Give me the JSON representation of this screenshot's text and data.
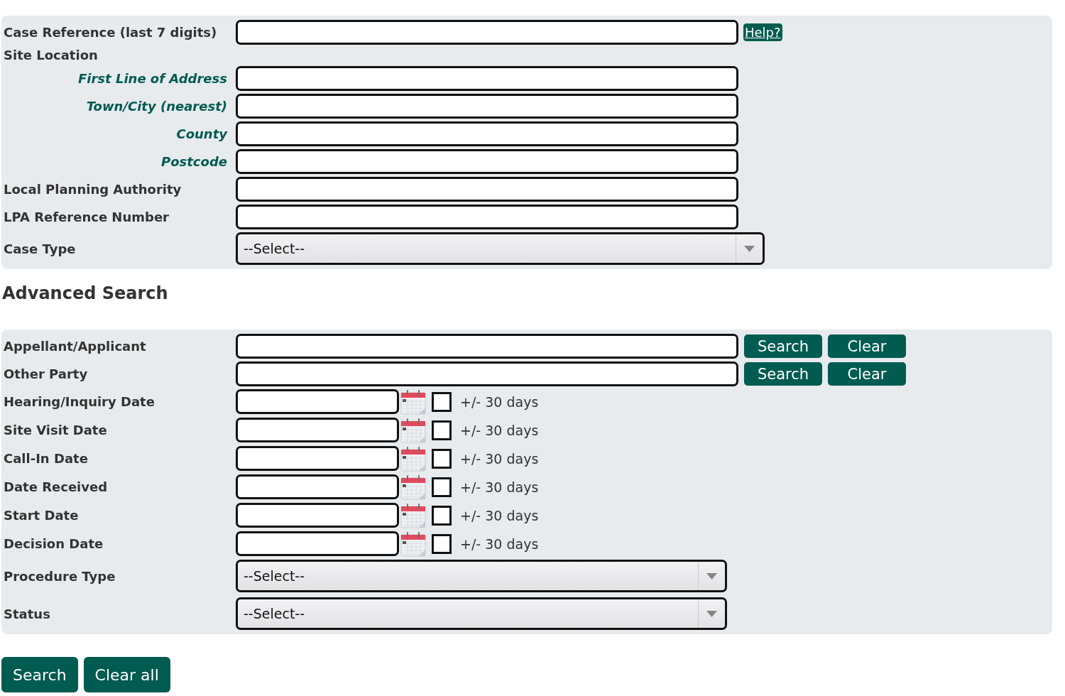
{
  "case_search": {
    "rows": [
      {
        "kind": "text",
        "label": "Case Reference (last 7 digits)",
        "help_link": "Help?"
      },
      {
        "kind": "group",
        "label": "Site Location",
        "children": [
          {
            "kind": "text",
            "label": "First Line of Address"
          },
          {
            "kind": "text",
            "label": "Town/City (nearest)"
          },
          {
            "kind": "text",
            "label": "County"
          },
          {
            "kind": "text",
            "label": "Postcode"
          }
        ]
      },
      {
        "kind": "text",
        "label": "Local Planning Authority"
      },
      {
        "kind": "text",
        "label": "LPA Reference Number"
      },
      {
        "kind": "select",
        "label": "Case Type",
        "value": "--Select--"
      }
    ]
  },
  "advanced_search": {
    "heading": "Advanced Search",
    "rows": [
      {
        "kind": "lookup",
        "label": "Appellant/Applicant",
        "buttons": [
          "Search",
          "Clear"
        ]
      },
      {
        "kind": "lookup",
        "label": "Other Party",
        "buttons": [
          "Search",
          "Clear"
        ]
      },
      {
        "kind": "date",
        "label": "Hearing/Inquiry Date",
        "checked": false,
        "range_label": "+/- 30 days"
      },
      {
        "kind": "date",
        "label": "Site Visit Date",
        "checked": false,
        "range_label": "+/- 30 days"
      },
      {
        "kind": "date",
        "label": "Call-In Date",
        "checked": false,
        "range_label": "+/- 30 days"
      },
      {
        "kind": "date",
        "label": "Date Received",
        "checked": false,
        "range_label": "+/- 30 days"
      },
      {
        "kind": "date",
        "label": "Start Date",
        "checked": false,
        "range_label": "+/- 30 days"
      },
      {
        "kind": "date",
        "label": "Decision Date",
        "checked": false,
        "range_label": "+/- 30 days"
      },
      {
        "kind": "select",
        "label": "Procedure Type",
        "value": "--Select--"
      },
      {
        "kind": "select",
        "label": "Status",
        "value": "--Select--"
      }
    ]
  },
  "actions": [
    "Search",
    "Clear all"
  ]
}
